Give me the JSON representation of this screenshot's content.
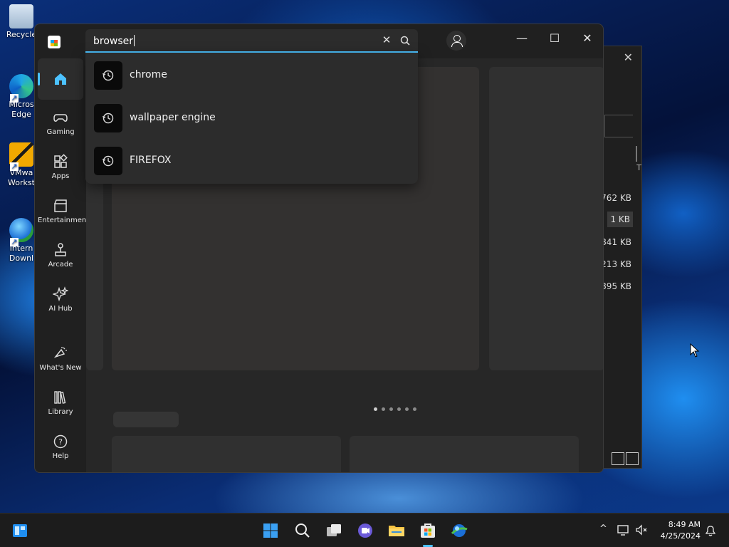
{
  "desktop": {
    "icons": [
      {
        "label": "Recycle",
        "icon": "recycle-bin-icon"
      },
      {
        "label": "Micros Edge",
        "icon": "edge-icon"
      },
      {
        "label": "VMwa Workst",
        "icon": "vmware-icon"
      },
      {
        "label": "Intern Downl",
        "icon": "download-manager-icon"
      }
    ]
  },
  "explorer": {
    "sizes": [
      "762 KB",
      "1 KB",
      "841 KB",
      "213 KB",
      "895 KB"
    ],
    "column_hint": "T"
  },
  "store": {
    "window_controls": {
      "minimize": "—",
      "maximize": "☐",
      "close": "✕"
    },
    "search": {
      "value": "browser",
      "clear": "✕"
    },
    "suggestions": [
      {
        "label": "chrome",
        "icon": "history-icon"
      },
      {
        "label": "wallpaper engine",
        "icon": "history-icon"
      },
      {
        "label": "FIREFOX",
        "icon": "history-icon"
      }
    ],
    "nav": [
      {
        "label": "",
        "icon": "home-icon",
        "active": true
      },
      {
        "label": "Gaming",
        "icon": "gamepad-icon"
      },
      {
        "label": "Apps",
        "icon": "apps-icon"
      },
      {
        "label": "Entertainment",
        "icon": "clapper-icon"
      },
      {
        "label": "Arcade",
        "icon": "joystick-icon"
      },
      {
        "label": "AI Hub",
        "icon": "sparkle-icon"
      },
      {
        "label": "What's New",
        "icon": "megaphone-icon"
      },
      {
        "label": "Library",
        "icon": "library-icon"
      },
      {
        "label": "Help",
        "icon": "help-icon"
      }
    ],
    "carousel": {
      "pages": 6,
      "active": 0
    },
    "pager": {
      "prev": "◀",
      "next": "▶"
    }
  },
  "taskbar": {
    "time": "8:49 AM",
    "date": "4/25/2024",
    "tray": {
      "chevron": "^"
    }
  },
  "colors": {
    "accent": "#4cc2ff",
    "window_bg": "#202020",
    "content_bg": "#272727"
  }
}
